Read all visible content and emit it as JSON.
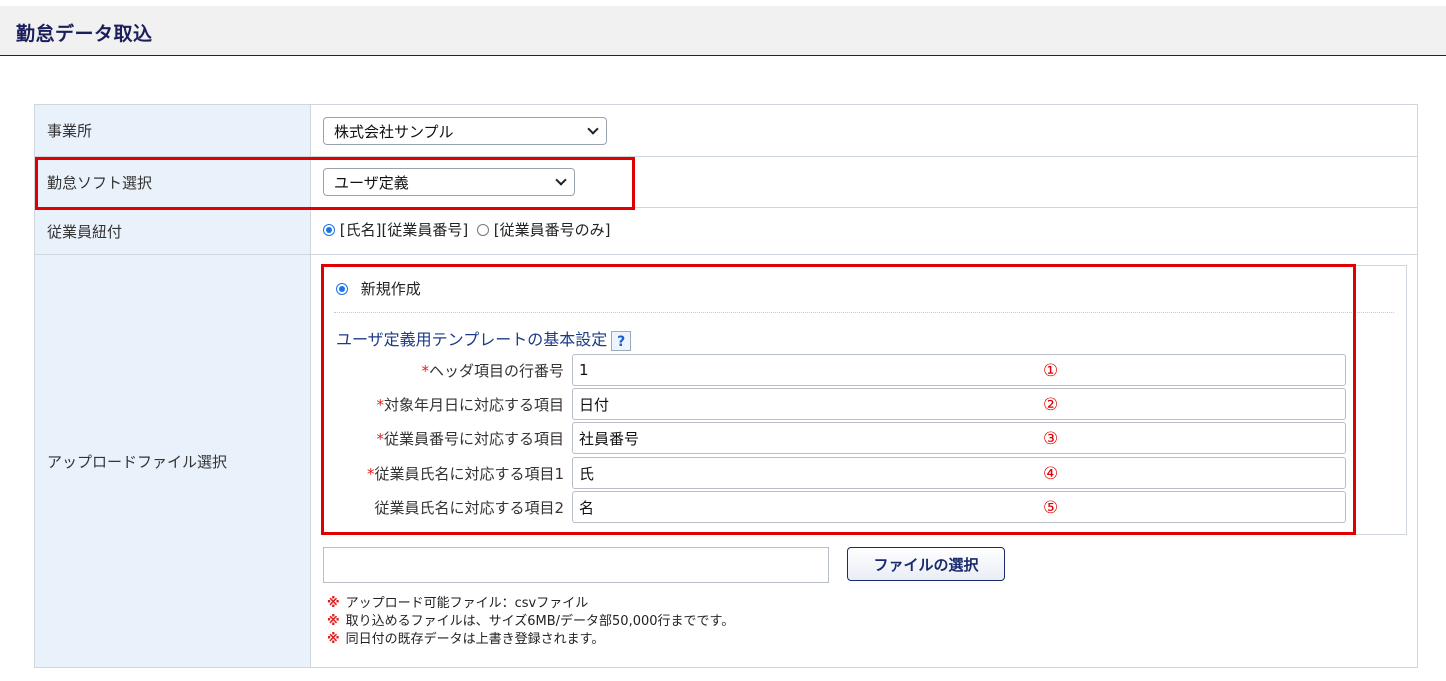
{
  "page": {
    "title": "勤怠データ取込"
  },
  "rows": {
    "office": {
      "label": "事業所",
      "selected": "株式会社サンプル"
    },
    "software": {
      "label": "勤怠ソフト選択",
      "selected": "ユーザ定義"
    },
    "link": {
      "label": "従業員紐付",
      "option1": "[氏名][従業員番号]",
      "option2": "[従業員番号のみ]",
      "selected_option": "option1"
    },
    "upload": {
      "label": "アップロードファイル選択",
      "new_create": "新規作成",
      "template_title": "ユーザ定義用テンプレートの基本設定",
      "help": "?",
      "fields": [
        {
          "required": true,
          "label": "ヘッダ項目の行番号",
          "value": "1",
          "marker": "①"
        },
        {
          "required": true,
          "label": "対象年月日に対応する項目",
          "value": "日付",
          "marker": "②"
        },
        {
          "required": true,
          "label": "従業員番号に対応する項目",
          "value": "社員番号",
          "marker": "③"
        },
        {
          "required": true,
          "label": "従業員氏名に対応する項目1",
          "value": "氏",
          "marker": "④"
        },
        {
          "required": false,
          "label": "従業員氏名に対応する項目2",
          "value": "名",
          "marker": "⑤"
        }
      ],
      "file_path": "",
      "file_button": "ファイルの選択",
      "note_mark": "※",
      "notes": [
        "アップロード可能ファイル：csvファイル",
        "取り込めるファイルは、サイズ6MB/データ部50,000行までです。",
        "同日付の既存データは上書き登録されます。"
      ]
    }
  },
  "colors": {
    "title": "#1a1e5a",
    "label_bg": "#e9f2fb",
    "highlight": "#e10000",
    "required": "#e02020"
  }
}
